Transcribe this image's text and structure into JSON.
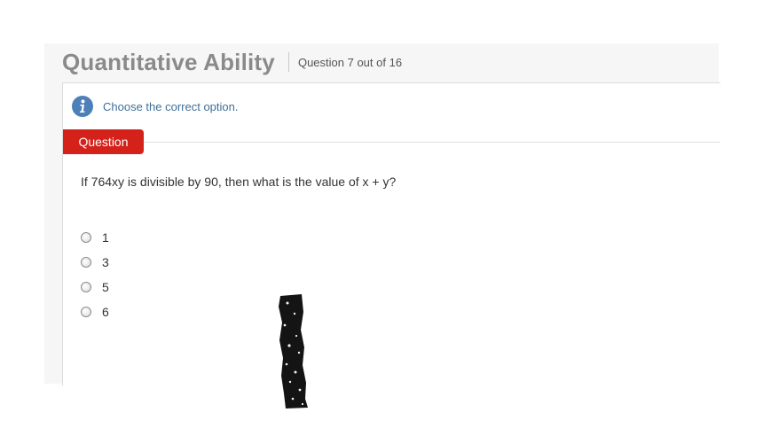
{
  "header": {
    "title": "Quantitative Ability",
    "progress_text": "Question 7 out of 16"
  },
  "instruction": {
    "icon": "info-icon",
    "text": "Choose the correct option."
  },
  "question": {
    "tab_label": "Question",
    "text": "If 764xy is divisible by 90, then what is the value of x + y?",
    "options": [
      {
        "label": "1",
        "selected": false
      },
      {
        "label": "3",
        "selected": false
      },
      {
        "label": "5",
        "selected": false
      },
      {
        "label": "6",
        "selected": false
      }
    ]
  },
  "colors": {
    "accent_red": "#d4221b",
    "info_blue": "#4d7fb8",
    "title_gray": "#8a8a8a"
  }
}
